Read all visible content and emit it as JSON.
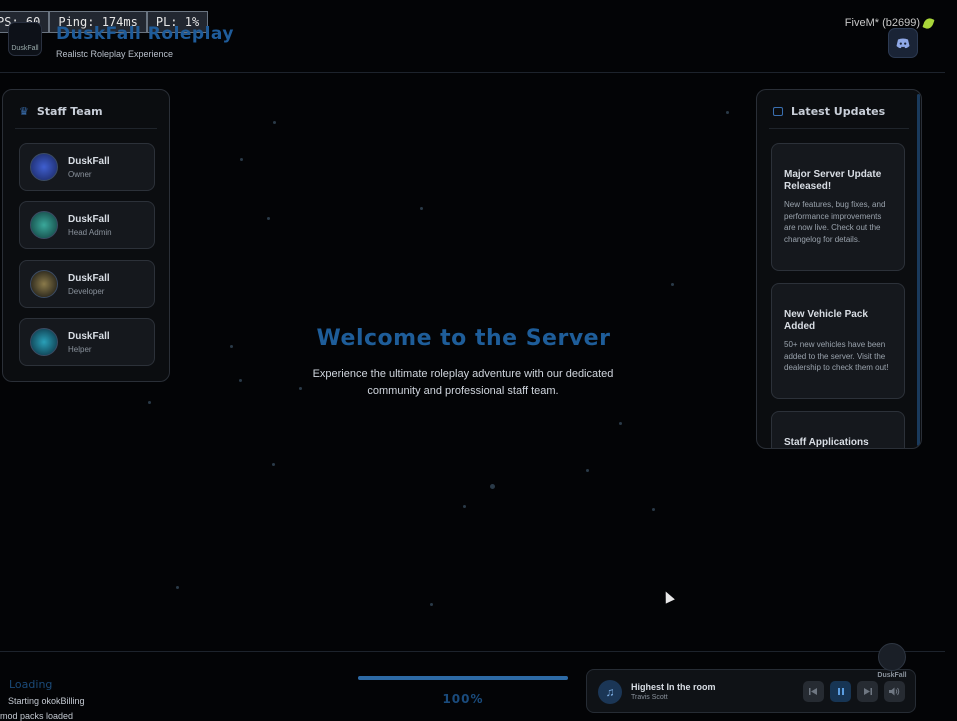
{
  "perf": {
    "fps": "PS: 60",
    "ping": "Ping: 174ms",
    "pl": "PL: 1%"
  },
  "brand": {
    "logo_text": "DuskFall",
    "title": "DuskFall Roleplay",
    "subtitle": "Realistc Roleplay Experience"
  },
  "client": {
    "label": "FiveM* (b2699)"
  },
  "staff": {
    "title": "Staff Team",
    "members": [
      {
        "name": "DuskFall",
        "role": "Owner"
      },
      {
        "name": "DuskFall",
        "role": "Head Admin"
      },
      {
        "name": "DuskFall",
        "role": "Developer"
      },
      {
        "name": "DuskFall",
        "role": "Helper"
      }
    ]
  },
  "updates": {
    "title": "Latest Updates",
    "items": [
      {
        "title": "Major Server Update Released!",
        "body": "New features, bug fixes, and performance improvements are now live. Check out the changelog for details."
      },
      {
        "title": "New Vehicle Pack Added",
        "body": "50+ new vehicles have been added to the server. Visit the dealership to check them out!"
      },
      {
        "title": "Staff Applications",
        "body": ""
      }
    ]
  },
  "welcome": {
    "title": "Welcome to the Server",
    "line1": "Experience the ultimate roleplay adventure with our dedicated",
    "line2": "community and professional staff team."
  },
  "loading": {
    "label": "Loading",
    "log": [
      "Starting okokBilling",
      "mod packs loaded"
    ],
    "progress_percent": 100,
    "progress_label": "100%"
  },
  "music": {
    "title": "Highest In the room",
    "artist": "Travis Scott"
  },
  "corner_logo_text": "DuskFall",
  "colors": {
    "accent": "#1e5d99",
    "background": "#030406",
    "panel": "#15181d"
  }
}
